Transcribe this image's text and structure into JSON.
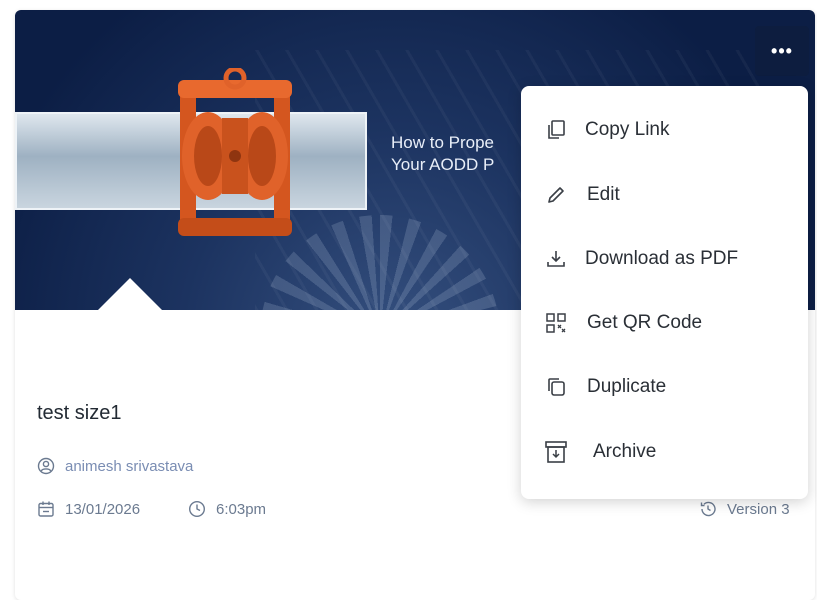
{
  "card": {
    "banner_title": "How to Prope\nYour AODD P",
    "more_label": "•••",
    "title": "test size1",
    "author": "animesh srivastava",
    "date": "13/01/2026",
    "time": "6:03pm",
    "version": "Version 3"
  },
  "menu": {
    "items": [
      {
        "label": "Copy Link",
        "icon": "copy-link-icon"
      },
      {
        "label": "Edit",
        "icon": "pencil-icon"
      },
      {
        "label": "Download as PDF",
        "icon": "download-icon"
      },
      {
        "label": "Get QR Code",
        "icon": "qr-code-icon"
      },
      {
        "label": "Duplicate",
        "icon": "duplicate-icon"
      },
      {
        "label": "Archive",
        "icon": "archive-icon"
      }
    ]
  },
  "colors": {
    "banner_navy": "#0c1e45",
    "pump_orange": "#e0622a",
    "meta_blue": "#7a8db3",
    "text_dark": "#222a33"
  }
}
